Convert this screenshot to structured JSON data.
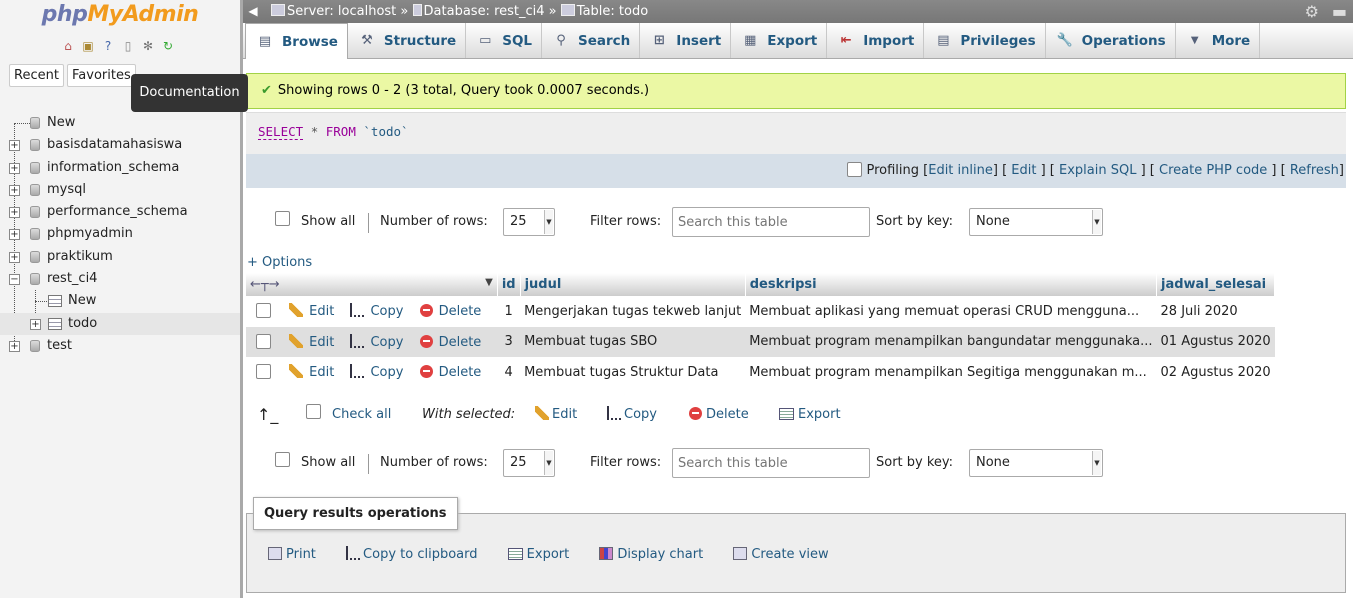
{
  "app": {
    "logo_php": "php",
    "logo_myadmin": "MyAdmin"
  },
  "nav": {
    "recent_label": "Recent",
    "favorites_label": "Favorites",
    "tooltip": "Documentation",
    "tree": [
      {
        "label": "New"
      },
      {
        "label": "basisdatamahasiswa"
      },
      {
        "label": "information_schema"
      },
      {
        "label": "mysql"
      },
      {
        "label": "performance_schema"
      },
      {
        "label": "phpmyadmin"
      },
      {
        "label": "praktikum"
      },
      {
        "label": "rest_ci4"
      },
      {
        "label": "New"
      },
      {
        "label": "todo"
      },
      {
        "label": "test"
      }
    ]
  },
  "breadcrumb": {
    "server": "Server: localhost",
    "database": "Database: rest_ci4",
    "table": "Table: todo",
    "separator": "»"
  },
  "tabs": [
    {
      "label": "Browse",
      "icon": "browse-icon"
    },
    {
      "label": "Structure",
      "icon": "structure-icon"
    },
    {
      "label": "SQL",
      "icon": "sql-icon"
    },
    {
      "label": "Search",
      "icon": "search-icon"
    },
    {
      "label": "Insert",
      "icon": "insert-icon"
    },
    {
      "label": "Export",
      "icon": "export-icon"
    },
    {
      "label": "Import",
      "icon": "import-icon"
    },
    {
      "label": "Privileges",
      "icon": "privileges-icon"
    },
    {
      "label": "Operations",
      "icon": "operations-icon"
    },
    {
      "label": "More",
      "icon": "chevron-down-icon"
    }
  ],
  "message": {
    "success": "Showing rows 0 - 2 (3 total, Query took 0.0007 seconds.)"
  },
  "sql": {
    "select": "SELECT",
    "star": "*",
    "from": "FROM",
    "table": "`todo`"
  },
  "sql_actions": {
    "profiling": "Profiling",
    "edit_inline": "Edit inline",
    "edit": "Edit",
    "explain": "Explain SQL",
    "create_php": "Create PHP code",
    "refresh": "Refresh"
  },
  "controls": {
    "show_all": "Show all",
    "number_of_rows_label": "Number of rows:",
    "number_of_rows_value": "25",
    "filter_rows_label": "Filter rows:",
    "filter_placeholder": "Search this table",
    "sort_by_key_label": "Sort by key:",
    "sort_by_key_value": "None"
  },
  "options_label": "+ Options",
  "table": {
    "columns": [
      "id",
      "judul",
      "deskripsi",
      "jadwal_selesai"
    ],
    "row_actions": {
      "edit": "Edit",
      "copy": "Copy",
      "delete": "Delete"
    },
    "rows": [
      {
        "id": "1",
        "judul": "Mengerjakan tugas tekweb lanjut",
        "deskripsi": "Membuat aplikasi yang memuat operasi CRUD mengguna...",
        "jadwal_selesai": "28 Juli 2020"
      },
      {
        "id": "3",
        "judul": "Membuat tugas SBO",
        "deskripsi": "Membuat program menampilkan bangundatar menggunaka...",
        "jadwal_selesai": "01 Agustus 2020"
      },
      {
        "id": "4",
        "judul": "Membuat tugas Struktur Data",
        "deskripsi": "Membuat program menampilkan Segitiga menggunakan m...",
        "jadwal_selesai": "02 Agustus 2020"
      }
    ]
  },
  "with_selected": {
    "check_all": "Check all",
    "label": "With selected:",
    "edit": "Edit",
    "copy": "Copy",
    "delete": "Delete",
    "export": "Export"
  },
  "query_ops": {
    "title": "Query results operations",
    "print": "Print",
    "copy_clipboard": "Copy to clipboard",
    "export": "Export",
    "display_chart": "Display chart",
    "create_view": "Create view"
  }
}
